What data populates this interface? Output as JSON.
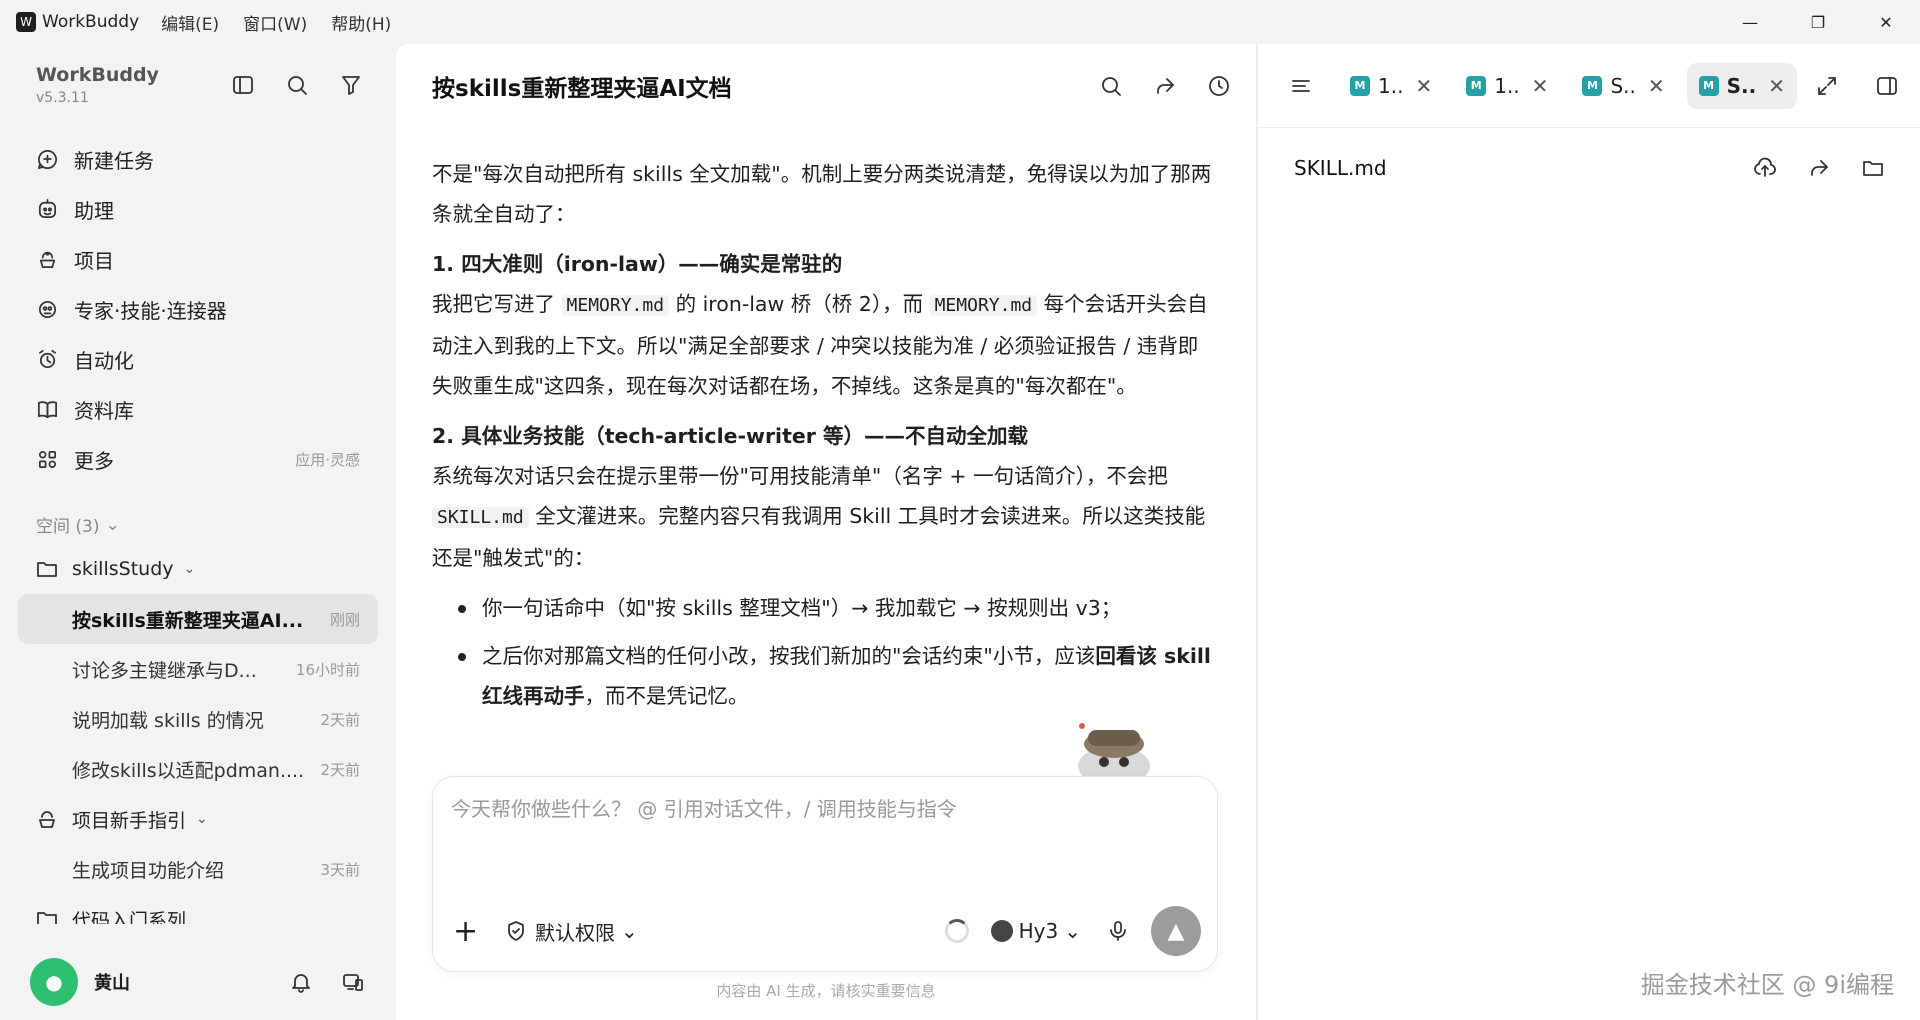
{
  "app": {
    "logo_glyph": "W",
    "title": "WorkBuddy",
    "menu": [
      "编辑(E)",
      "窗口(W)",
      "帮助(H)"
    ],
    "window_controls": [
      "—",
      "❐",
      "✕"
    ]
  },
  "sidebar": {
    "brand_name": "WorkBuddy",
    "version": "v5.3.11",
    "nav": [
      {
        "label": "新建任务",
        "icon": "new-task-icon"
      },
      {
        "label": "助理",
        "icon": "assistant-icon"
      },
      {
        "label": "项目",
        "icon": "project-icon"
      },
      {
        "label": "专家·技能·连接器",
        "icon": "expert-icon"
      },
      {
        "label": "自动化",
        "icon": "alarm-clock-icon"
      },
      {
        "label": "资料库",
        "icon": "book-icon"
      },
      {
        "label": "更多",
        "icon": "apps-icon",
        "hint": "应用·灵感"
      }
    ],
    "space_header": "空间 (3)",
    "folders": {
      "skills": {
        "label": "skillsStudy"
      },
      "onboarding": {
        "label": "项目新手指引"
      },
      "third": {
        "label": "代码入门系列"
      }
    },
    "tasks": [
      {
        "title": "按skills重新整理夹逼AI...",
        "time": "刚刚"
      },
      {
        "title": "讨论多主键继承与D...",
        "time": "16小时前"
      },
      {
        "title": "说明加载 skills 的情况",
        "time": "2天前"
      },
      {
        "title": "修改skills以适配pdman....",
        "time": "2天前"
      }
    ],
    "onboarding_task": {
      "title": "生成项目功能介绍",
      "time": "3天前"
    },
    "user": {
      "name": "黄山",
      "avatar_glyph": "●"
    }
  },
  "chat": {
    "title": "按skills重新整理夹逼AI文档",
    "intro": "不是\"每次自动把所有 skills 全文加载\"。机制上要分两类说清楚，免得误以为加了那两条就全自动了：",
    "section1_title": "1. 四大准则（iron-law）——确实是常驻的",
    "s1_a": "我把它写进了 ",
    "s1_code1": "MEMORY.md",
    "s1_b": " 的 iron-law 桥（桥 2），而 ",
    "s1_code2": "MEMORY.md",
    "s1_c": " 每个会话开头会自动注入到我的上下文。所以\"满足全部要求 / 冲突以技能为准 / 必须验证报告 / 违背即失败重生成\"这四条，现在每次对话都在场，不掉线。这条是真的\"每次都在\"。",
    "section2_title": "2. 具体业务技能（tech-article-writer 等）——不自动全加载",
    "s2_a": "系统每次对话只会在提示里带一份\"可用技能清单\"（名字 + 一句话简介），不会把 ",
    "s2_code": "SKILL.md",
    "s2_b": " 全文灌进来。完整内容只有我调用 Skill 工具时才会读进来。所以这类技能还是\"触发式\"的：",
    "bullet1": "你一句话命中（如\"按 skills 整理文档\"）→ 我加载它 → 按规则出 v3；",
    "bullet2_a": "之后你对那篇文档的任何小改，按我们新加的\"会话约束\"小节，应该",
    "bullet2_b": "回看该 skill 红线再动手",
    "bullet2_c": "，而不是凭记忆。",
    "composer_placeholder": "今天帮你做些什么？ @ 引用对话文件，/ 调用技能与指令",
    "plus": "+",
    "permission": "默认权限",
    "model": "Hy3",
    "send_glyph": "▲",
    "disclaimer": "内容由 AI 生成，请核实重要信息"
  },
  "viewer": {
    "tabs": [
      {
        "label": "1.."
      },
      {
        "label": "1.."
      },
      {
        "label": "S.."
      },
      {
        "label": "S..",
        "active": true
      }
    ],
    "md_badge": "M",
    "close_glyph": "✕",
    "file_name": "SKILL.md",
    "watermark": "掘金技术社区 @ 9i编程"
  }
}
